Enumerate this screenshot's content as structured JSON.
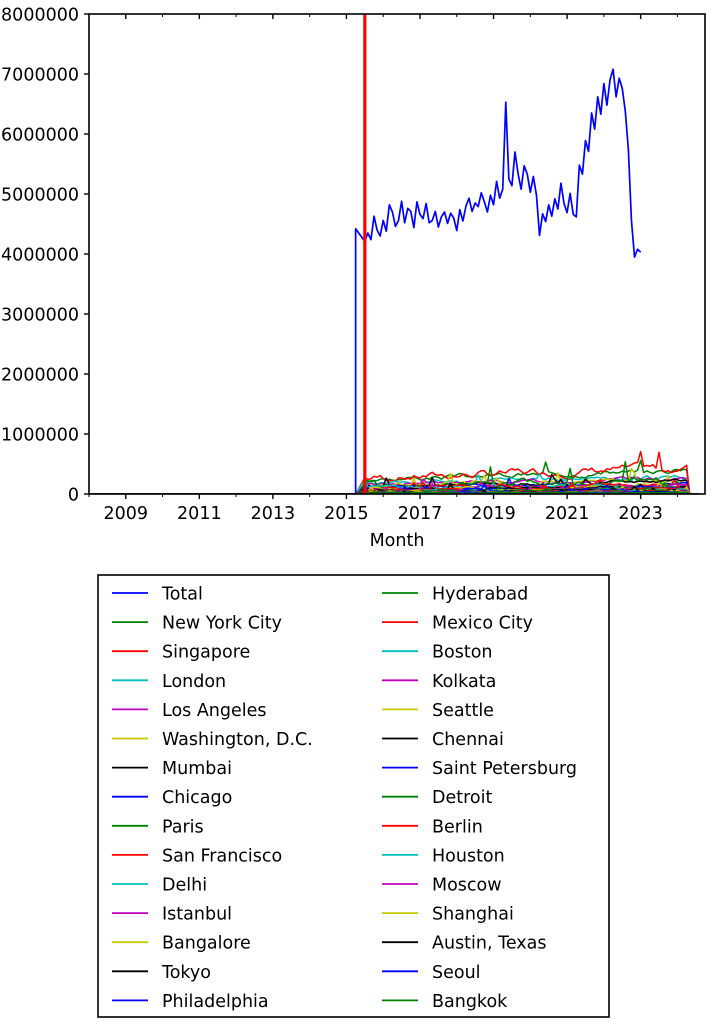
{
  "chart_data": {
    "type": "line",
    "title": "",
    "xlabel": "Month",
    "ylabel": "",
    "grid": false,
    "legend_position": "below-axes-two-columns",
    "xlim": [
      2008.0,
      2024.75
    ],
    "ylim": [
      0,
      8000000
    ],
    "yticks": [
      0,
      1000000,
      2000000,
      3000000,
      4000000,
      5000000,
      6000000,
      7000000,
      8000000
    ],
    "ytick_labels": [
      "0",
      "1000000",
      "2000000",
      "3000000",
      "4000000",
      "5000000",
      "6000000",
      "7000000",
      "8000000"
    ],
    "xticks": [
      2009,
      2011,
      2013,
      2015,
      2017,
      2019,
      2021,
      2023
    ],
    "xtick_labels": [
      "2009",
      "2011",
      "2013",
      "2015",
      "2017",
      "2019",
      "2021",
      "2023"
    ],
    "annotations": [
      {
        "name": "vertical-marker-line",
        "type": "vline",
        "x": 2015.5,
        "color": "#ff0000"
      }
    ],
    "x": [
      2008.0,
      2008.25,
      2008.5,
      2008.75,
      2009.0,
      2009.25,
      2009.5,
      2009.75,
      2010.0,
      2010.25,
      2010.5,
      2010.75,
      2011.0,
      2011.25,
      2011.5,
      2011.75,
      2012.0,
      2012.25,
      2012.5,
      2012.75,
      2013.0,
      2013.25,
      2013.5,
      2013.75,
      2014.0,
      2014.25,
      2014.5,
      2014.75,
      2015.0,
      2015.25,
      2015.5,
      2015.583,
      2015.667,
      2015.75,
      2015.833,
      2015.917,
      2016.0,
      2016.083,
      2016.167,
      2016.25,
      2016.333,
      2016.417,
      2016.5,
      2016.583,
      2016.667,
      2016.75,
      2016.833,
      2016.917,
      2017.0,
      2017.083,
      2017.167,
      2017.25,
      2017.333,
      2017.417,
      2017.5,
      2017.583,
      2017.667,
      2017.75,
      2017.833,
      2017.917,
      2018.0,
      2018.083,
      2018.167,
      2018.25,
      2018.333,
      2018.417,
      2018.5,
      2018.583,
      2018.667,
      2018.75,
      2018.833,
      2018.917,
      2019.0,
      2019.083,
      2019.167,
      2019.25,
      2019.333,
      2019.417,
      2019.5,
      2019.583,
      2019.667,
      2019.75,
      2019.833,
      2019.917,
      2020.0,
      2020.083,
      2020.167,
      2020.25,
      2020.333,
      2020.417,
      2020.5,
      2020.583,
      2020.667,
      2020.75,
      2020.833,
      2020.917,
      2021.0,
      2021.083,
      2021.167,
      2021.25,
      2021.333,
      2021.417,
      2021.5,
      2021.583,
      2021.667,
      2021.75,
      2021.833,
      2021.917,
      2022.0,
      2022.083,
      2022.167,
      2022.25,
      2022.333,
      2022.417,
      2022.5,
      2022.583,
      2022.667,
      2022.75,
      2022.833,
      2022.917,
      2023.0,
      2023.083,
      2023.167,
      2023.25,
      2023.333,
      2023.417,
      2023.5,
      2023.583,
      2023.667,
      2023.75,
      2023.833,
      2023.917,
      2024.0,
      2024.083,
      2024.167,
      2024.25,
      2024.333,
      2024.417,
      2024.5,
      2024.583
    ],
    "series": [
      {
        "name": "Total",
        "color": "#0000ff",
        "values": [
          0,
          0,
          0,
          0,
          0,
          0,
          0,
          0,
          0,
          0,
          0,
          0,
          0,
          0,
          0,
          0,
          0,
          0,
          0,
          0,
          0,
          0,
          0,
          0,
          0,
          0,
          0,
          4480000,
          4180000,
          4420000,
          4210000,
          4350000,
          4240000,
          4630000,
          4400000,
          4300000,
          4560000,
          4380000,
          4820000,
          4700000,
          4460000,
          4560000,
          4880000,
          4520000,
          4760000,
          4710000,
          4440000,
          4870000,
          4660000,
          4590000,
          4840000,
          4520000,
          4560000,
          4710000,
          4450000,
          4620000,
          4700000,
          4510000,
          4680000,
          4600000,
          4390000,
          4740000,
          4550000,
          4800000,
          4930000,
          4710000,
          4850000,
          4790000,
          5020000,
          4870000,
          4700000,
          4980000,
          4820000,
          5210000,
          4930000,
          5080000,
          6530000,
          5250000,
          5140000,
          5700000,
          5340000,
          5080000,
          5470000,
          5330000,
          5030000,
          5290000,
          4980000,
          4310000,
          4670000,
          4540000,
          4820000,
          4630000,
          4920000,
          4750000,
          5180000,
          4840000,
          4690000,
          5010000,
          4660000,
          4620000,
          5480000,
          5330000,
          5890000,
          5710000,
          6350000,
          6080000,
          6620000,
          6330000,
          6840000,
          6480000,
          6900000,
          7080000,
          6620000,
          6930000,
          6760000,
          6380000,
          5730000,
          4560000,
          3950000,
          4080000,
          4030000,
          0,
          0,
          0,
          0,
          0,
          0,
          0,
          0
        ]
      },
      {
        "name": "New York City",
        "color": "#008000",
        "base": 300000,
        "amp": 40000,
        "seed": 3
      },
      {
        "name": "Singapore",
        "color": "#ff0000",
        "base": 330000,
        "amp": 60000,
        "seed": 7
      },
      {
        "name": "London",
        "color": "#00c0c0",
        "base": 215000,
        "amp": 35000,
        "seed": 11
      },
      {
        "name": "Los Angeles",
        "color": "#c000c0",
        "base": 195000,
        "amp": 28000,
        "seed": 13
      },
      {
        "name": "Washington, D.C.",
        "color": "#c8c800",
        "base": 175000,
        "amp": 45000,
        "seed": 17
      },
      {
        "name": "Mumbai",
        "color": "#000000",
        "base": 160000,
        "amp": 30000,
        "seed": 19
      },
      {
        "name": "Chicago",
        "color": "#0000ff",
        "base": 135000,
        "amp": 24000,
        "seed": 23
      },
      {
        "name": "Paris",
        "color": "#008000",
        "base": 150000,
        "amp": 60000,
        "seed": 29
      },
      {
        "name": "San Francisco",
        "color": "#ff0000",
        "base": 120000,
        "amp": 22000,
        "seed": 31
      },
      {
        "name": "Delhi",
        "color": "#00c0c0",
        "base": 110000,
        "amp": 30000,
        "seed": 37
      },
      {
        "name": "Istanbul",
        "color": "#c000c0",
        "base": 100000,
        "amp": 20000,
        "seed": 41
      },
      {
        "name": "Bangalore",
        "color": "#c8c800",
        "base": 95000,
        "amp": 22000,
        "seed": 43
      },
      {
        "name": "Tokyo",
        "color": "#000000",
        "base": 88000,
        "amp": 18000,
        "seed": 47
      },
      {
        "name": "Philadelphia",
        "color": "#0000ff",
        "base": 80000,
        "amp": 16000,
        "seed": 53
      },
      {
        "name": "Hyderabad",
        "color": "#008000",
        "base": 74000,
        "amp": 15000,
        "seed": 59
      },
      {
        "name": "Mexico City",
        "color": "#ff0000",
        "base": 68000,
        "amp": 14000,
        "seed": 61
      },
      {
        "name": "Boston",
        "color": "#00c0c0",
        "base": 62000,
        "amp": 13000,
        "seed": 67
      },
      {
        "name": "Kolkata",
        "color": "#c000c0",
        "base": 57000,
        "amp": 12000,
        "seed": 71
      },
      {
        "name": "Seattle",
        "color": "#c8c800",
        "base": 53000,
        "amp": 12000,
        "seed": 73
      },
      {
        "name": "Chennai",
        "color": "#000000",
        "base": 48000,
        "amp": 11000,
        "seed": 79
      },
      {
        "name": "Saint Petersburg",
        "color": "#0000ff",
        "base": 44000,
        "amp": 10000,
        "seed": 83
      },
      {
        "name": "Detroit",
        "color": "#008000",
        "base": 40000,
        "amp": 9000,
        "seed": 89
      },
      {
        "name": "Berlin",
        "color": "#ff0000",
        "base": 36000,
        "amp": 9000,
        "seed": 97
      },
      {
        "name": "Houston",
        "color": "#00c0c0",
        "base": 33000,
        "amp": 8000,
        "seed": 101
      },
      {
        "name": "Moscow",
        "color": "#c000c0",
        "base": 30000,
        "amp": 7000,
        "seed": 103
      },
      {
        "name": "Shanghai",
        "color": "#c8c800",
        "base": 27000,
        "amp": 7000,
        "seed": 107
      },
      {
        "name": "Austin, Texas",
        "color": "#000000",
        "base": 24000,
        "amp": 6000,
        "seed": 109
      },
      {
        "name": "Seoul",
        "color": "#0000ff",
        "base": 21000,
        "amp": 6000,
        "seed": 113
      },
      {
        "name": "Bangkok",
        "color": "#008000",
        "base": 18000,
        "amp": 5000,
        "seed": 127
      }
    ]
  },
  "axes": {
    "xlabel": "Month",
    "ytick_labels": [
      "8000000",
      "7000000",
      "6000000",
      "5000000",
      "4000000",
      "3000000",
      "2000000",
      "1000000",
      "0"
    ],
    "xtick_labels": [
      "2009",
      "2011",
      "2013",
      "2015",
      "2017",
      "2019",
      "2021",
      "2023"
    ]
  },
  "legend": {
    "columns": [
      {
        "items": [
          {
            "label": "Total",
            "color": "#0000ff"
          },
          {
            "label": "New York City",
            "color": "#008000"
          },
          {
            "label": "Singapore",
            "color": "#ff0000"
          },
          {
            "label": "London",
            "color": "#00c0c0"
          },
          {
            "label": "Los Angeles",
            "color": "#c000c0"
          },
          {
            "label": "Washington, D.C.",
            "color": "#c8c800"
          },
          {
            "label": "Mumbai",
            "color": "#000000"
          },
          {
            "label": "Chicago",
            "color": "#0000ff"
          },
          {
            "label": "Paris",
            "color": "#008000"
          },
          {
            "label": "San Francisco",
            "color": "#ff0000"
          },
          {
            "label": "Delhi",
            "color": "#00c0c0"
          },
          {
            "label": "Istanbul",
            "color": "#c000c0"
          },
          {
            "label": "Bangalore",
            "color": "#c8c800"
          },
          {
            "label": "Tokyo",
            "color": "#000000"
          },
          {
            "label": "Philadelphia",
            "color": "#0000ff"
          }
        ]
      },
      {
        "items": [
          {
            "label": "Hyderabad",
            "color": "#008000"
          },
          {
            "label": "Mexico City",
            "color": "#ff0000"
          },
          {
            "label": "Boston",
            "color": "#00c0c0"
          },
          {
            "label": "Kolkata",
            "color": "#c000c0"
          },
          {
            "label": "Seattle",
            "color": "#c8c800"
          },
          {
            "label": "Chennai",
            "color": "#000000"
          },
          {
            "label": "Saint Petersburg",
            "color": "#0000ff"
          },
          {
            "label": "Detroit",
            "color": "#008000"
          },
          {
            "label": "Berlin",
            "color": "#ff0000"
          },
          {
            "label": "Houston",
            "color": "#00c0c0"
          },
          {
            "label": "Moscow",
            "color": "#c000c0"
          },
          {
            "label": "Shanghai",
            "color": "#c8c800"
          },
          {
            "label": "Austin, Texas",
            "color": "#000000"
          },
          {
            "label": "Seoul",
            "color": "#0000ff"
          },
          {
            "label": "Bangkok",
            "color": "#008000"
          }
        ]
      }
    ]
  }
}
